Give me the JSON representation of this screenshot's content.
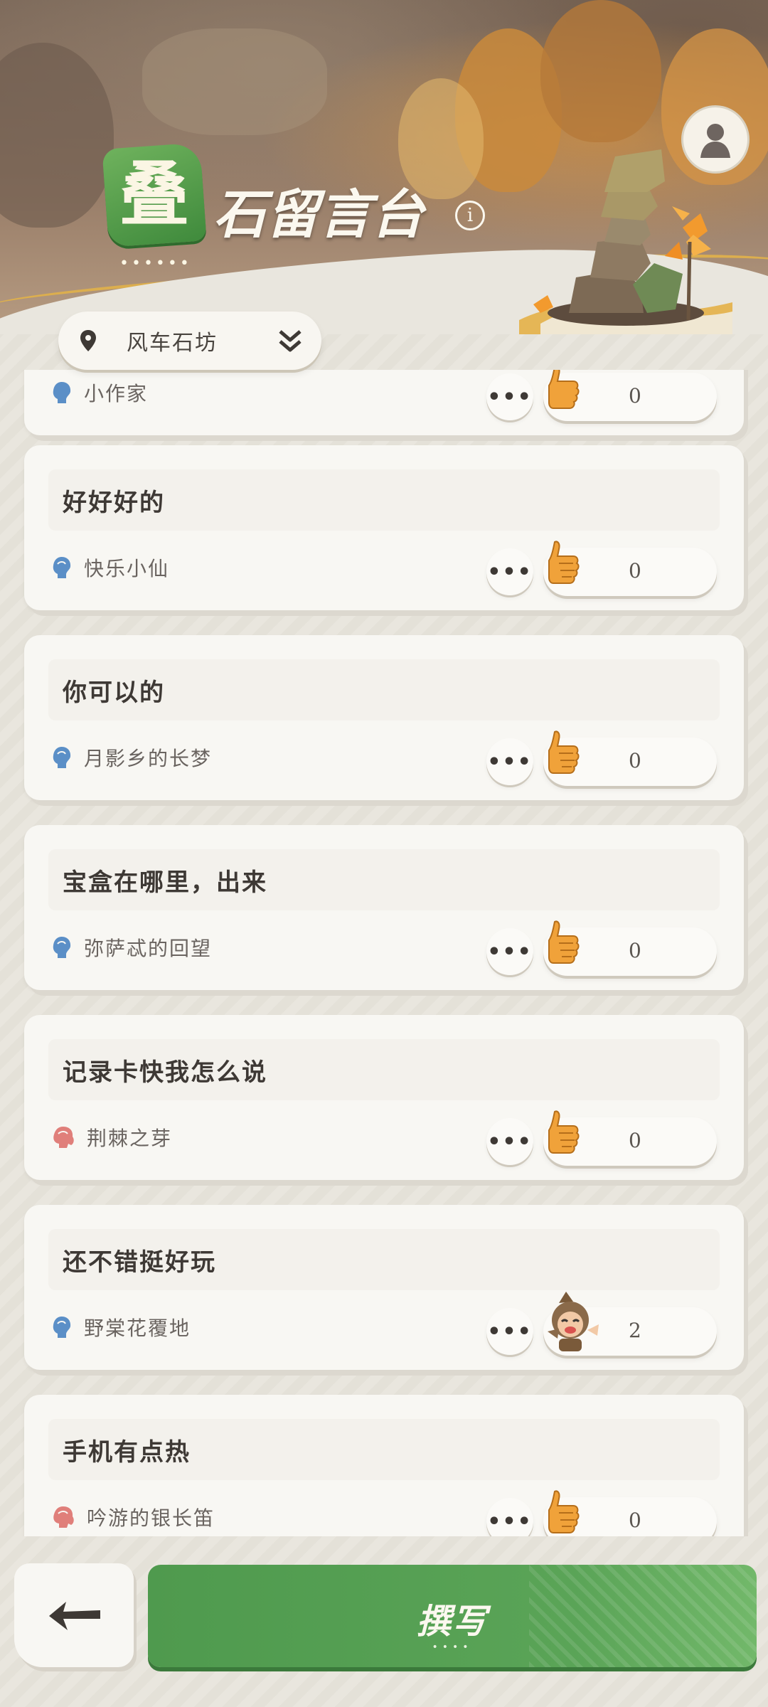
{
  "header": {
    "logo_glyph": "叠",
    "title": "石留言台",
    "info_label": "i",
    "avatar_icon": "user-silhouette-icon"
  },
  "location": {
    "name": "风车石坊"
  },
  "partial_top_card": {
    "author": "小作家",
    "likes": "0"
  },
  "messages": [
    {
      "text": "好好好的",
      "author": "快乐小仙",
      "gender": "male",
      "likes": "0",
      "reaction": "thumbs-up"
    },
    {
      "text": "你可以的",
      "author": "月影乡的长梦",
      "gender": "male",
      "likes": "0",
      "reaction": "thumbs-up"
    },
    {
      "text": "宝盒在哪里，出来",
      "author": "弥萨忒的回望",
      "gender": "male",
      "likes": "0",
      "reaction": "thumbs-up"
    },
    {
      "text": "记录卡快我怎么说",
      "author": "荆棘之芽",
      "gender": "female",
      "likes": "0",
      "reaction": "thumbs-up"
    },
    {
      "text": "还不错挺好玩",
      "author": "野棠花覆地",
      "gender": "male",
      "likes": "2",
      "reaction": "character-sticker"
    },
    {
      "text": "手机有点热",
      "author": "吟游的银长笛",
      "gender": "female",
      "likes": "0",
      "reaction": "thumbs-up"
    }
  ],
  "more_label": "•••",
  "bottom": {
    "back_icon": "back-arrow-icon",
    "write_label": "撰写",
    "write_dots": "••••"
  },
  "colors": {
    "accent_green": "#5aa457",
    "male_icon": "#5b8fc7",
    "female_icon": "#e07f7a",
    "thumb": "#f0a23a"
  }
}
